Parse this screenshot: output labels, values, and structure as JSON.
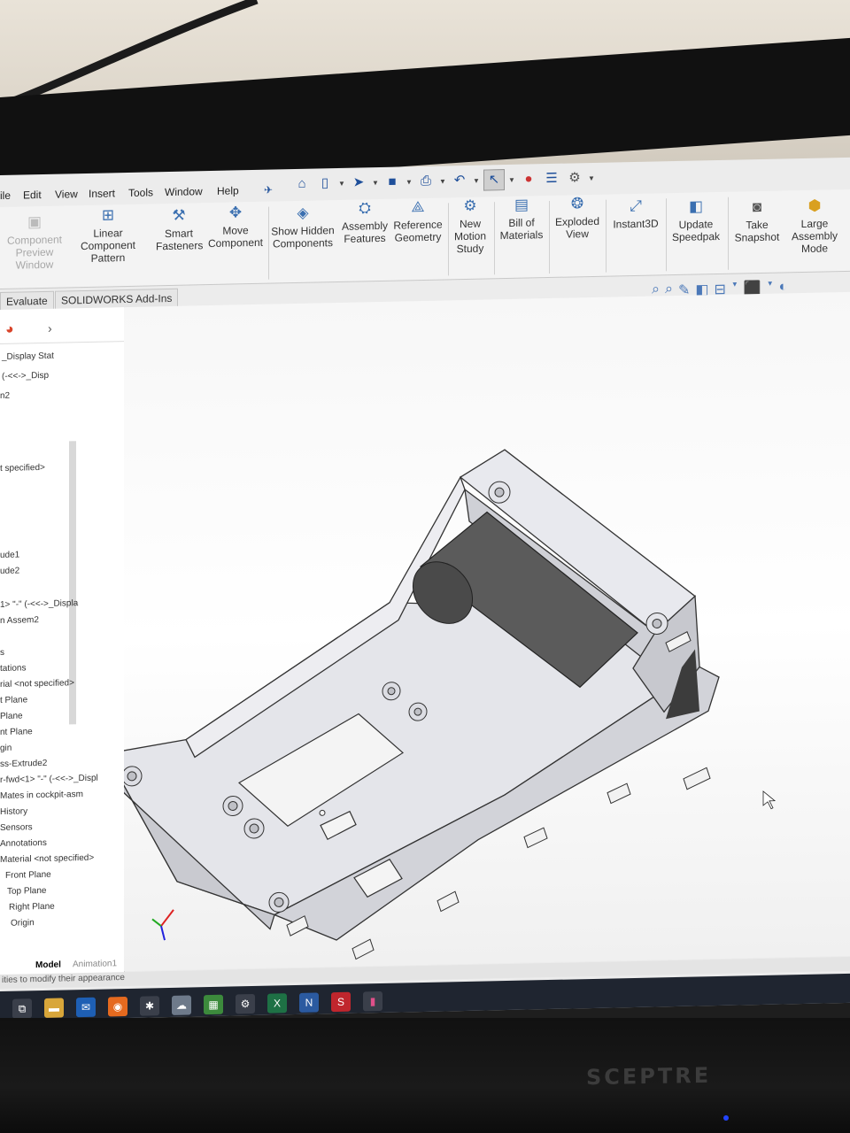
{
  "menubar": {
    "items": [
      "ile",
      "Edit",
      "View",
      "Insert",
      "Tools",
      "Window",
      "Help"
    ]
  },
  "ribbon": {
    "buttons": [
      {
        "label": "Component Preview Window",
        "icon": "component-preview-icon",
        "enabled": false
      },
      {
        "label": "Linear Component Pattern",
        "icon": "linear-pattern-icon"
      },
      {
        "label": "Smart Fasteners",
        "icon": "smart-fasteners-icon"
      },
      {
        "label": "Move Component",
        "icon": "move-component-icon"
      },
      {
        "label": "Show Hidden Components",
        "icon": "show-hidden-icon"
      },
      {
        "label": "Assembly Features",
        "icon": "assembly-features-icon"
      },
      {
        "label": "Reference Geometry",
        "icon": "reference-geometry-icon"
      },
      {
        "label": "New Motion Study",
        "icon": "motion-study-icon"
      },
      {
        "label": "Bill of Materials",
        "icon": "bill-of-materials-icon"
      },
      {
        "label": "Exploded View",
        "icon": "exploded-view-icon"
      },
      {
        "label": "Instant3D",
        "icon": "instant3d-icon"
      },
      {
        "label": "Update Speedpak",
        "icon": "speedpak-icon"
      },
      {
        "label": "Take Snapshot",
        "icon": "camera-icon"
      },
      {
        "label": "Large Assembly Mode",
        "icon": "large-assembly-icon"
      }
    ]
  },
  "tabs": {
    "evaluate": "Evaluate",
    "addins": "SOLIDWORKS Add-Ins"
  },
  "tree": {
    "items": [
      "_Display Stat",
      "(-<<->_Disp",
      "n2",
      "t specified>",
      "ude1",
      "ude2",
      "1> \"-\" (-<<->_Displa",
      "n Assem2",
      "s",
      "tations",
      "rial <not specified>",
      "t Plane",
      "Plane",
      "nt Plane",
      "gin",
      "ss-Extrude2",
      "r-fwd<1> \"-\" (-<<->_Displ",
      "Mates in cockpit-asm",
      "History",
      "Sensors",
      "Annotations",
      "Material <not specified>",
      "Front Plane",
      "Top Plane",
      "Right Plane",
      "Origin"
    ]
  },
  "bottom_tabs": {
    "model": "Model",
    "animation": "Animation1"
  },
  "status": {
    "text": "ities to modify their appearance"
  },
  "monitor": {
    "brand": "SCEPTRE"
  },
  "colors": {
    "ribbon_bg": "#f3f3f3",
    "icon_accent": "#3a6fb0",
    "part_face": "#dcdde3",
    "part_shadow": "#8a8b90",
    "cylinder": "#5a5a5a"
  }
}
